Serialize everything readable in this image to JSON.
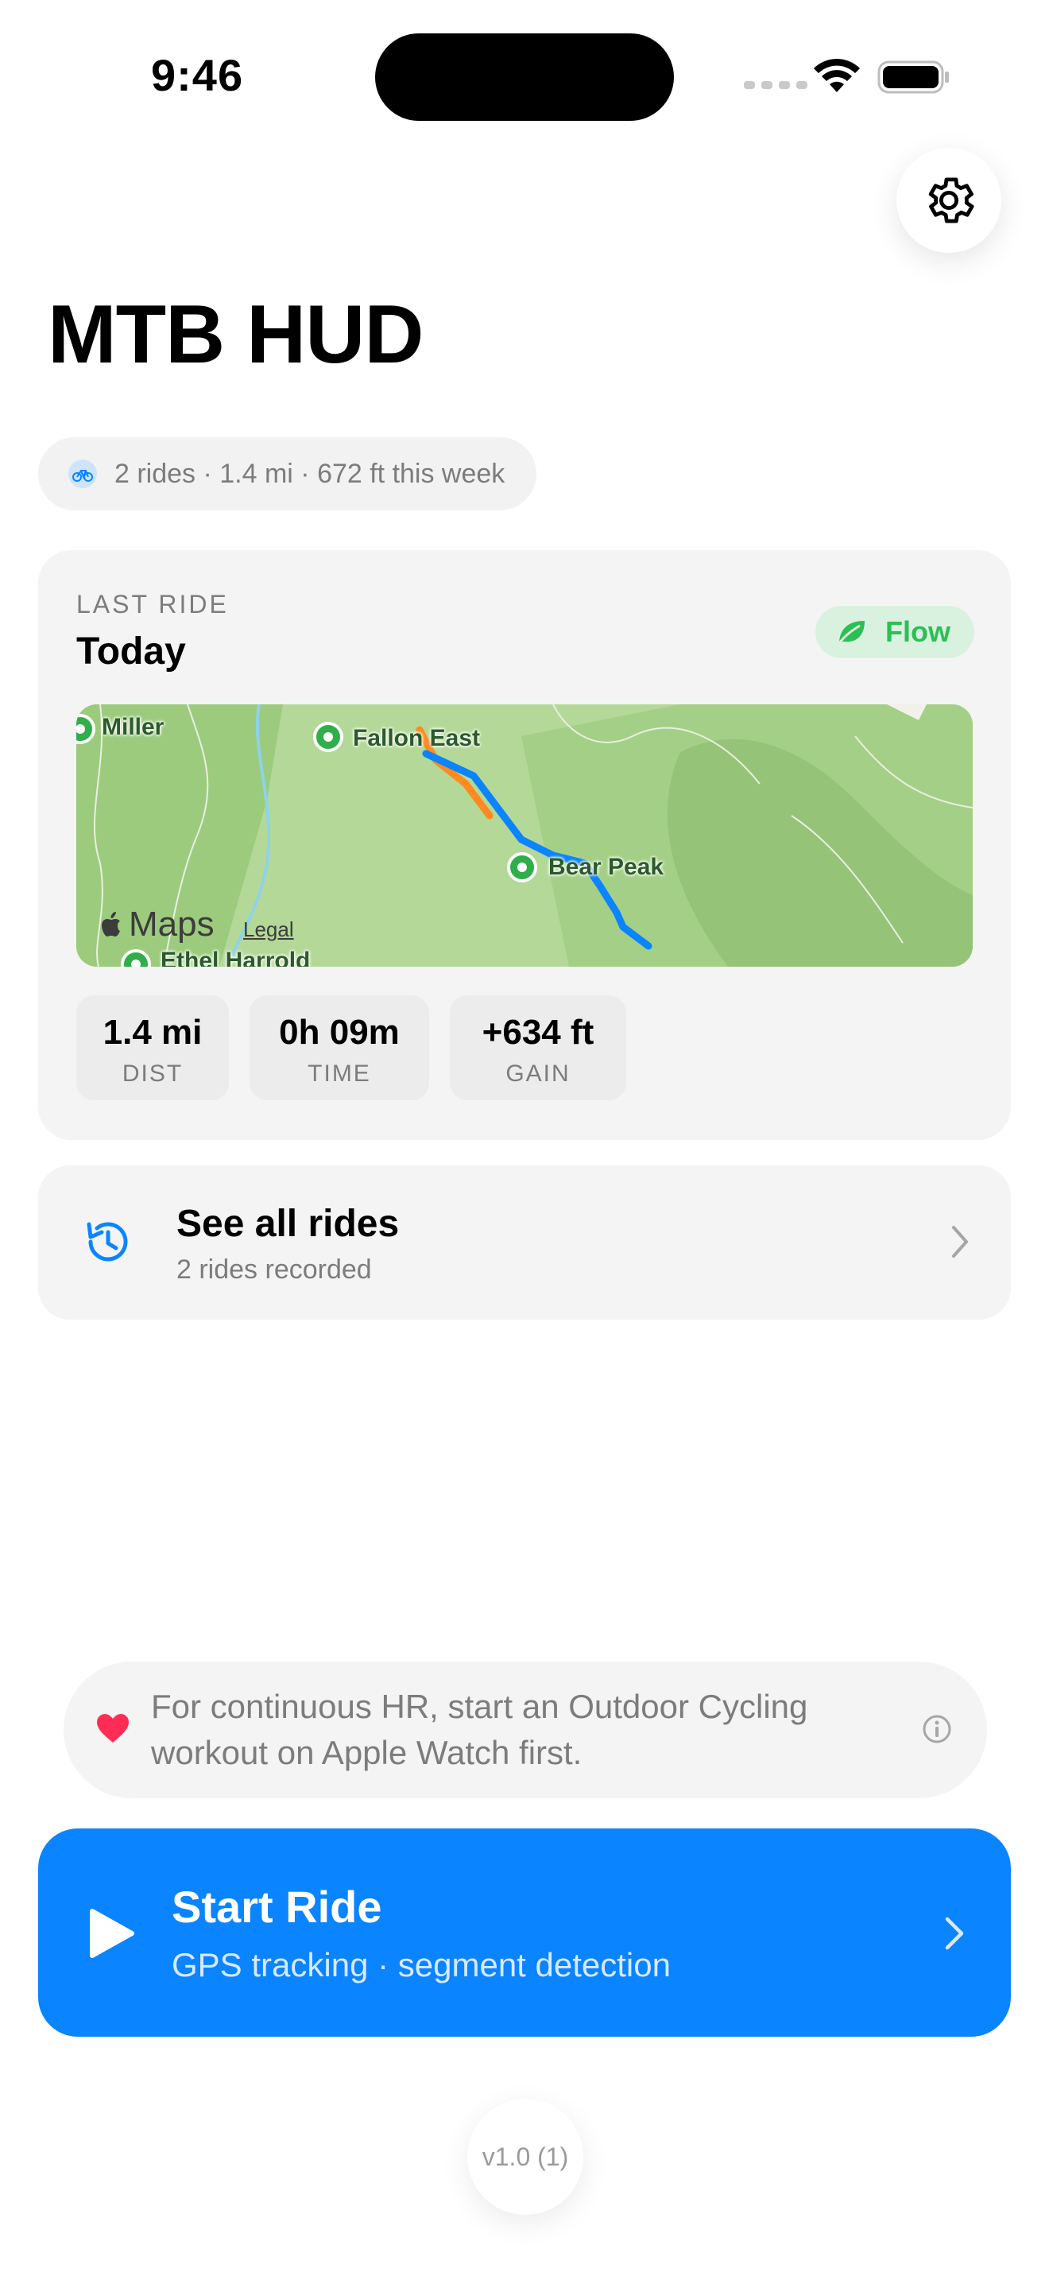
{
  "status_bar": {
    "time": "9:46",
    "icons": [
      "cellular-icon",
      "wifi-icon",
      "battery-icon"
    ]
  },
  "header": {
    "title": "MTB HUD",
    "settings_icon": "gear-icon"
  },
  "weekly_summary": {
    "icon": "bicycle-icon",
    "text": "2 rides · 1.4 mi · 672 ft this week"
  },
  "last_ride": {
    "label": "LAST RIDE",
    "date": "Today",
    "flow_badge": {
      "icon": "leaf-icon",
      "label": "Flow",
      "color": "#2dbe54"
    },
    "map": {
      "places": [
        "Miller",
        "Fallon East",
        "Bear Peak",
        "Ethel Harrold"
      ],
      "brand": "Maps",
      "legal": "Legal",
      "route_colors": {
        "main": "#0a84ff",
        "segment": "#ff8a1f"
      }
    },
    "stats": [
      {
        "value": "1.4 mi",
        "label": "DIST"
      },
      {
        "value": "0h 09m",
        "label": "TIME"
      },
      {
        "value": "+634 ft",
        "label": "GAIN"
      }
    ]
  },
  "all_rides": {
    "icon": "history-icon",
    "title": "See all rides",
    "subtitle": "2 rides recorded"
  },
  "hr_note": {
    "icon": "heart-icon",
    "text": "For continuous HR, start an Outdoor Cycling workout on Apple Watch first.",
    "info_icon": "info-icon"
  },
  "start_ride": {
    "icon": "play-icon",
    "title": "Start Ride",
    "subtitle": "GPS tracking · segment detection",
    "color": "#0a84ff"
  },
  "version": "v1.0 (1)"
}
